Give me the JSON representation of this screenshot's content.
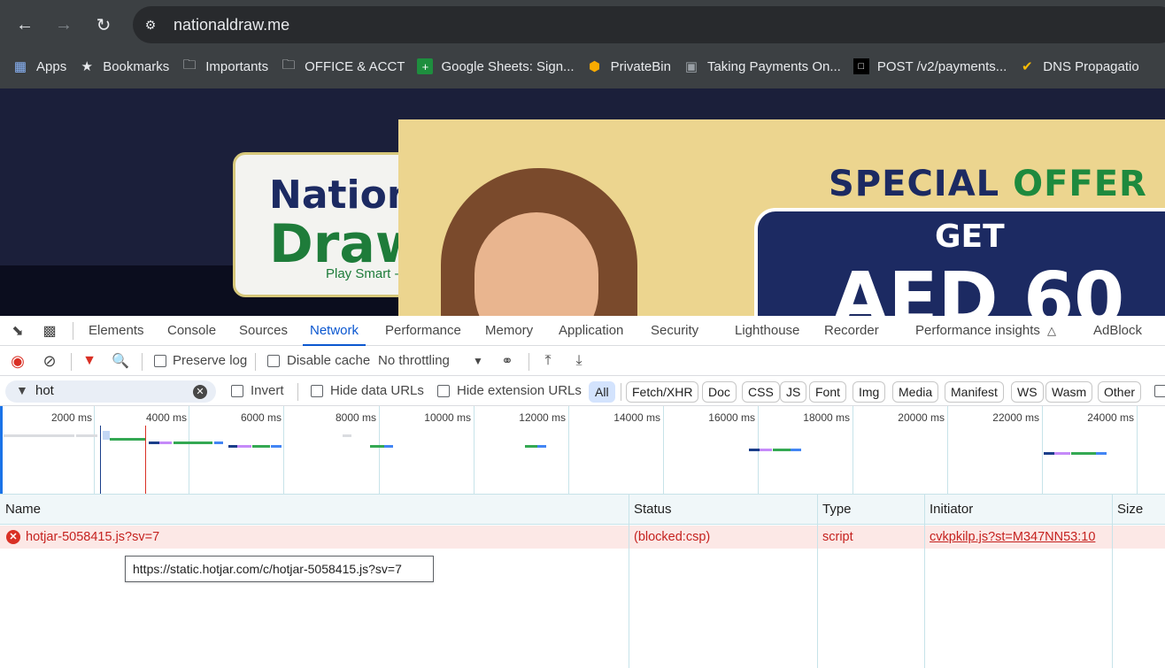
{
  "browser": {
    "url": "nationaldraw.me",
    "bookmarks": [
      {
        "icon": "apps-grid-icon",
        "label": "Apps"
      },
      {
        "icon": "star-icon",
        "label": "Bookmarks"
      },
      {
        "icon": "folder-icon",
        "label": "Importants"
      },
      {
        "icon": "folder-icon",
        "label": "OFFICE & ACCT"
      },
      {
        "icon": "google-sheets-icon",
        "label": "Google Sheets: Sign..."
      },
      {
        "icon": "privatebin-icon",
        "label": "PrivateBin"
      },
      {
        "icon": "page-icon",
        "label": "Taking Payments On..."
      },
      {
        "icon": "square-icon",
        "label": "POST /v2/payments..."
      },
      {
        "icon": "dns-icon",
        "label": "DNS Propagatio"
      }
    ]
  },
  "website": {
    "logo_line1": "Nation",
    "logo_line2": "Draw",
    "logo_tagline": "Play Smart -",
    "offer_word1": "SPECIAL",
    "offer_word2": "OFFER",
    "get": "GET",
    "amount": "AED 60"
  },
  "devtools": {
    "tabs": [
      "Elements",
      "Console",
      "Sources",
      "Network",
      "Performance",
      "Memory",
      "Application",
      "Security",
      "Lighthouse",
      "Recorder",
      "Performance insights",
      "AdBlock"
    ],
    "active_tab": "Network",
    "toolbar": {
      "preserve_log": "Preserve log",
      "disable_cache": "Disable cache",
      "throttling": "No throttling"
    },
    "filter": {
      "value": "hot",
      "invert": "Invert",
      "hide_data_urls": "Hide data URLs",
      "hide_extension_urls": "Hide extension URLs",
      "types": [
        "All",
        "Fetch/XHR",
        "Doc",
        "CSS",
        "JS",
        "Font",
        "Img",
        "Media",
        "Manifest",
        "WS",
        "Wasm",
        "Other"
      ]
    },
    "timeline_labels": [
      "2000 ms",
      "4000 ms",
      "6000 ms",
      "8000 ms",
      "10000 ms",
      "12000 ms",
      "14000 ms",
      "16000 ms",
      "18000 ms",
      "20000 ms",
      "22000 ms",
      "24000 ms"
    ],
    "columns": [
      "Name",
      "Status",
      "Type",
      "Initiator",
      "Size"
    ],
    "rows": [
      {
        "name": "hotjar-5058415.js?sv=7",
        "status": "(blocked:csp)",
        "type": "script",
        "initiator": "cvkpkilp.js?st=M347NN53:10",
        "size": ""
      }
    ],
    "tooltip": "https://static.hotjar.com/c/hotjar-5058415.js?sv=7"
  },
  "colors": {
    "accent": "#0b57d0",
    "error": "#c5221f",
    "error_row": "#fce8e6"
  }
}
